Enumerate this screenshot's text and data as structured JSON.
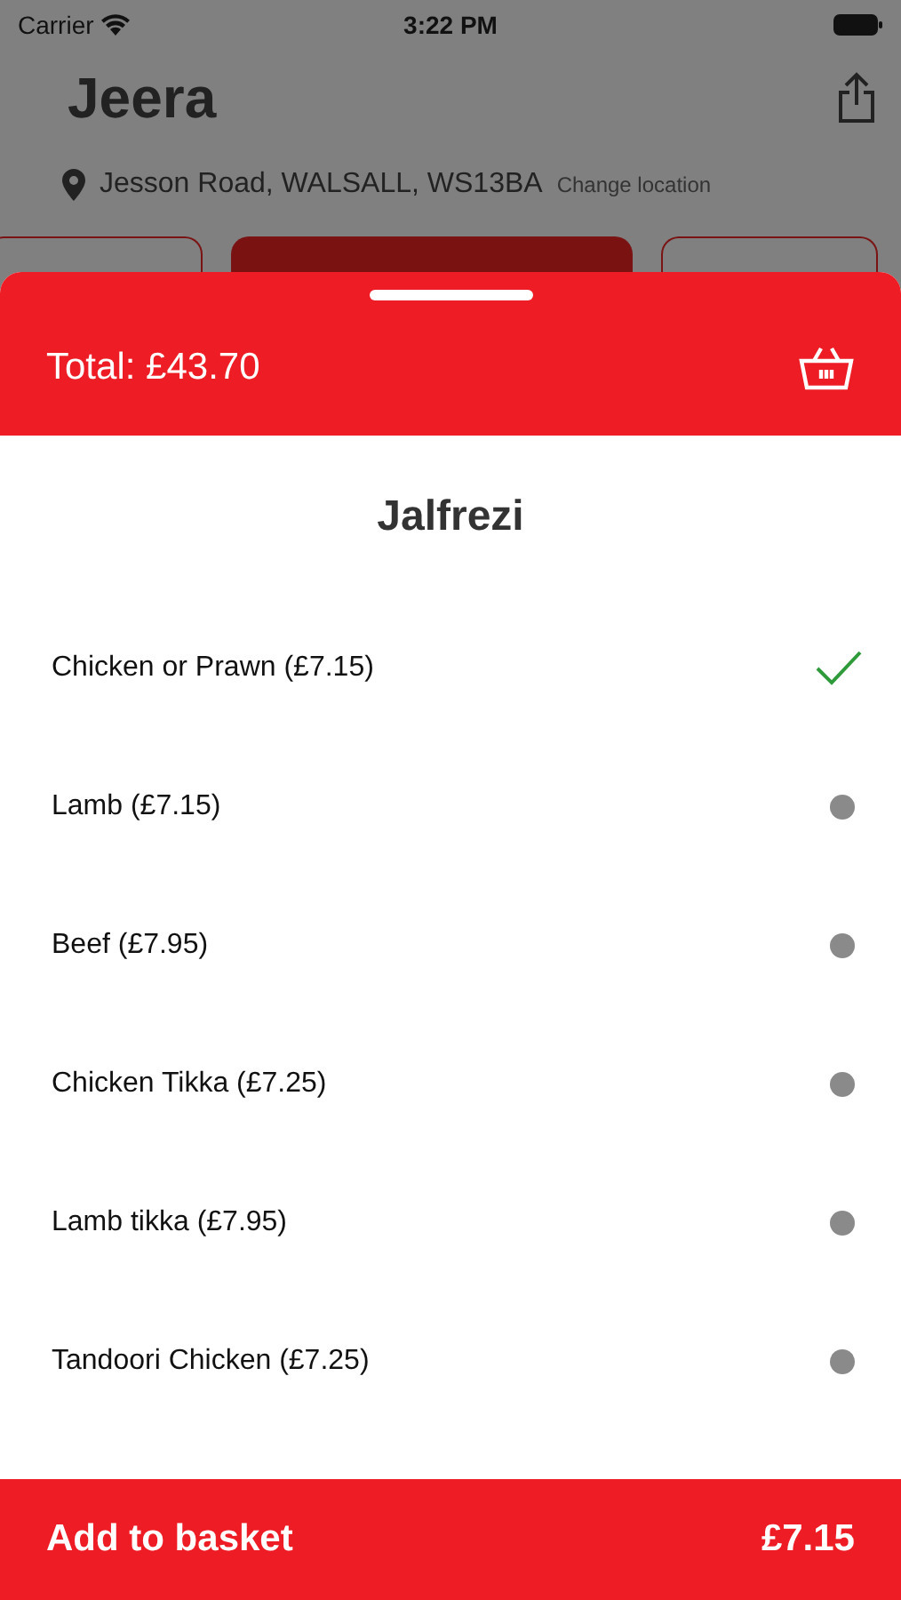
{
  "status_bar": {
    "carrier": "Carrier",
    "time": "3:22 PM"
  },
  "header": {
    "title": "Jeera",
    "address": "Jesson Road, WALSALL, WS13BA",
    "change_location": "Change location"
  },
  "category_chips": [
    {
      "selected": false
    },
    {
      "selected": true
    },
    {
      "selected": false
    }
  ],
  "sheet": {
    "total": "Total: £43.70",
    "title": "Jalfrezi",
    "options": [
      {
        "label": "Chicken or Prawn (£7.15)",
        "selected": true
      },
      {
        "label": "Lamb (£7.15)",
        "selected": false
      },
      {
        "label": "Beef (£7.95)",
        "selected": false
      },
      {
        "label": "Chicken Tikka (£7.25)",
        "selected": false
      },
      {
        "label": "Lamb tikka (£7.95)",
        "selected": false
      },
      {
        "label": "Tandoori Chicken (£7.25)",
        "selected": false
      }
    ],
    "add_button": {
      "label": "Add to basket",
      "price": "£7.15"
    }
  }
}
